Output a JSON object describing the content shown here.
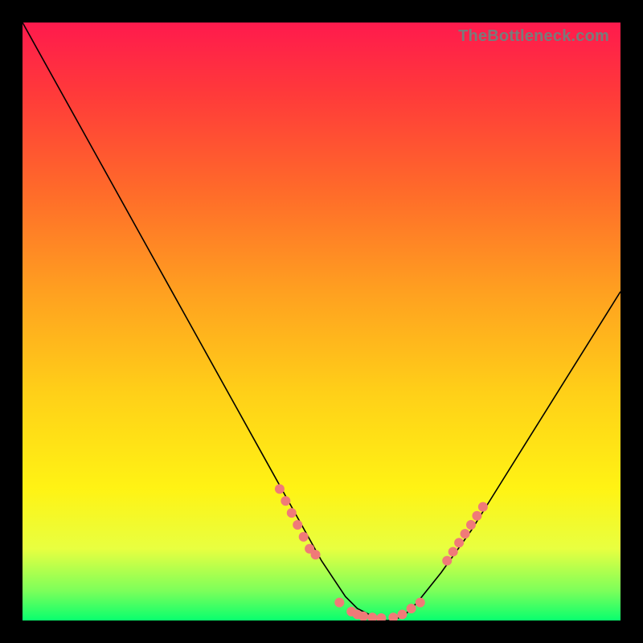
{
  "watermark": "TheBottleneck.com",
  "chart_data": {
    "type": "line",
    "title": "",
    "xlabel": "",
    "ylabel": "",
    "xlim": [
      0,
      100
    ],
    "ylim": [
      0,
      100
    ],
    "series": [
      {
        "name": "bottleneck-curve",
        "x": [
          0,
          5,
          10,
          15,
          20,
          25,
          30,
          35,
          40,
          45,
          50,
          52,
          54,
          56,
          58,
          60,
          62,
          64,
          66,
          70,
          75,
          80,
          85,
          90,
          95,
          100
        ],
        "y": [
          100,
          91,
          82,
          73,
          64,
          55,
          46,
          37,
          28,
          19,
          10,
          7,
          4,
          2,
          1,
          0,
          0,
          1,
          3,
          8,
          15,
          23,
          31,
          39,
          47,
          55
        ]
      }
    ],
    "markers": [
      {
        "x": 43,
        "y": 22
      },
      {
        "x": 44,
        "y": 20
      },
      {
        "x": 45,
        "y": 18
      },
      {
        "x": 46,
        "y": 16
      },
      {
        "x": 47,
        "y": 14
      },
      {
        "x": 48,
        "y": 12
      },
      {
        "x": 49,
        "y": 11
      },
      {
        "x": 53,
        "y": 3
      },
      {
        "x": 55,
        "y": 1.5
      },
      {
        "x": 56,
        "y": 1
      },
      {
        "x": 57,
        "y": 0.7
      },
      {
        "x": 58.5,
        "y": 0.5
      },
      {
        "x": 60,
        "y": 0.4
      },
      {
        "x": 62,
        "y": 0.5
      },
      {
        "x": 63.5,
        "y": 1
      },
      {
        "x": 65,
        "y": 2
      },
      {
        "x": 66.5,
        "y": 3
      },
      {
        "x": 71,
        "y": 10
      },
      {
        "x": 72,
        "y": 11.5
      },
      {
        "x": 73,
        "y": 13
      },
      {
        "x": 74,
        "y": 14.5
      },
      {
        "x": 75,
        "y": 16
      },
      {
        "x": 76,
        "y": 17.5
      },
      {
        "x": 77,
        "y": 19
      }
    ],
    "colors": {
      "curve": "#000000",
      "marker": "#f07a78",
      "gradient_top": "#ff1a4d",
      "gradient_bottom": "#08ff6e"
    }
  }
}
